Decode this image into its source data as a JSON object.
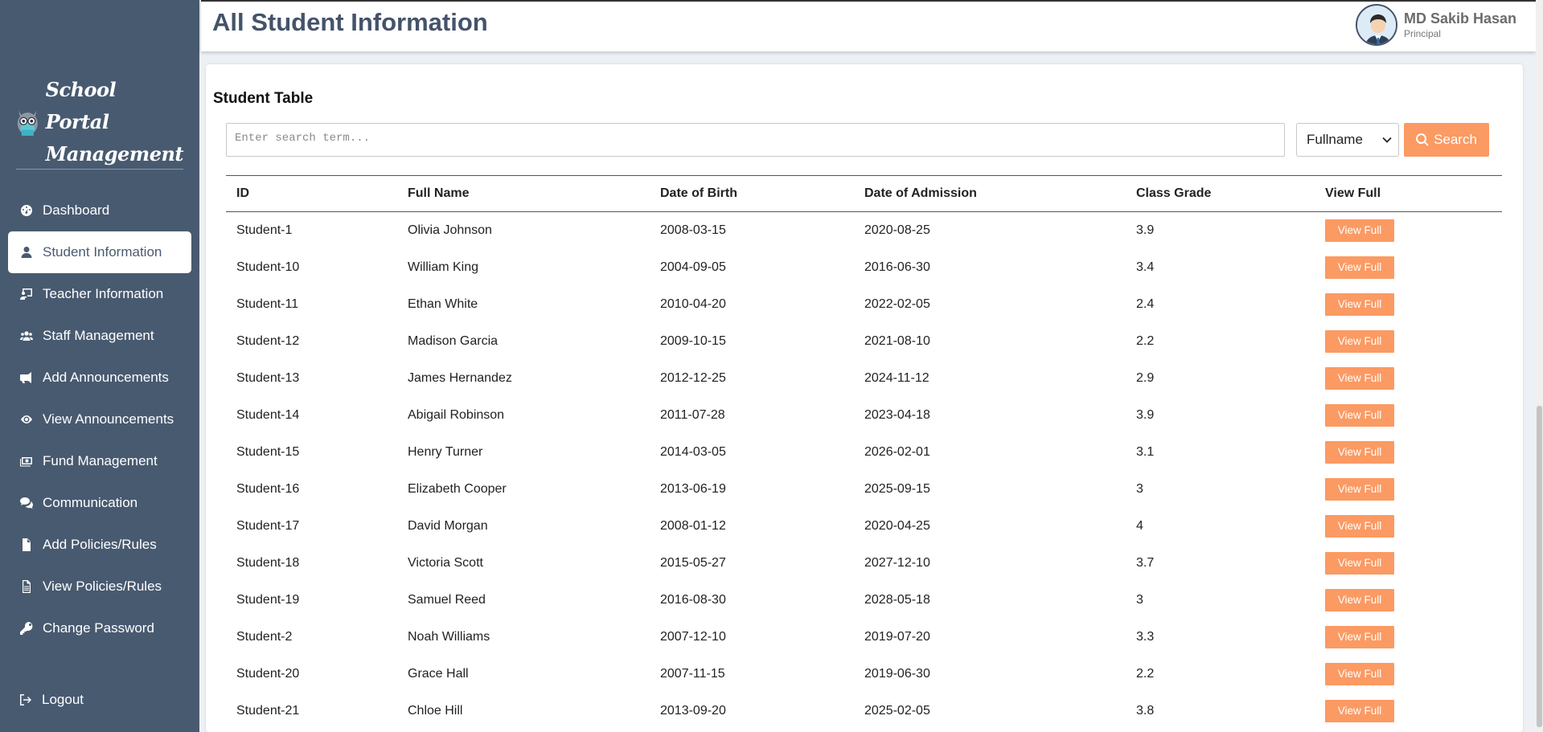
{
  "brand": {
    "line1": "School Portal",
    "line2": "Management"
  },
  "sidebar": {
    "items": [
      {
        "label": "Dashboard",
        "icon": "dashboard-icon"
      },
      {
        "label": "Student Information",
        "icon": "user-icon"
      },
      {
        "label": "Teacher Information",
        "icon": "chalkboard-icon"
      },
      {
        "label": "Staff Management",
        "icon": "users-icon"
      },
      {
        "label": "Add Announcements",
        "icon": "megaphone-icon"
      },
      {
        "label": "View Announcements",
        "icon": "eye-icon"
      },
      {
        "label": "Fund Management",
        "icon": "money-icon"
      },
      {
        "label": "Communication",
        "icon": "comments-icon"
      },
      {
        "label": "Add Policies/Rules",
        "icon": "file-icon"
      },
      {
        "label": "View Policies/Rules",
        "icon": "file-outline-icon"
      },
      {
        "label": "Change Password",
        "icon": "key-icon"
      }
    ],
    "active": "Student Information",
    "logout": "Logout"
  },
  "header": {
    "title": "All Student Information",
    "user_name": "MD Sakib Hasan",
    "user_role": "Principal"
  },
  "main": {
    "card_title": "Student Table",
    "search_placeholder": "Enter search term...",
    "filter_selected": "Fullname",
    "search_label": "Search",
    "columns": [
      "ID",
      "Full Name",
      "Date of Birth",
      "Date of Admission",
      "Class Grade",
      "View Full"
    ],
    "view_label": "View Full",
    "rows": [
      [
        "Student-1",
        "Olivia Johnson",
        "2008-03-15",
        "2020-08-25",
        "3.9"
      ],
      [
        "Student-10",
        "William King",
        "2004-09-05",
        "2016-06-30",
        "3.4"
      ],
      [
        "Student-11",
        "Ethan White",
        "2010-04-20",
        "2022-02-05",
        "2.4"
      ],
      [
        "Student-12",
        "Madison Garcia",
        "2009-10-15",
        "2021-08-10",
        "2.2"
      ],
      [
        "Student-13",
        "James Hernandez",
        "2012-12-25",
        "2024-11-12",
        "2.9"
      ],
      [
        "Student-14",
        "Abigail Robinson",
        "2011-07-28",
        "2023-04-18",
        "3.9"
      ],
      [
        "Student-15",
        "Henry Turner",
        "2014-03-05",
        "2026-02-01",
        "3.1"
      ],
      [
        "Student-16",
        "Elizabeth Cooper",
        "2013-06-19",
        "2025-09-15",
        "3"
      ],
      [
        "Student-17",
        "David Morgan",
        "2008-01-12",
        "2020-04-25",
        "4"
      ],
      [
        "Student-18",
        "Victoria Scott",
        "2015-05-27",
        "2027-12-10",
        "3.7"
      ],
      [
        "Student-19",
        "Samuel Reed",
        "2016-08-30",
        "2028-05-18",
        "3"
      ],
      [
        "Student-2",
        "Noah Williams",
        "2007-12-10",
        "2019-07-20",
        "3.3"
      ],
      [
        "Student-20",
        "Grace Hall",
        "2007-11-15",
        "2019-06-30",
        "2.2"
      ],
      [
        "Student-21",
        "Chloe Hill",
        "2013-09-20",
        "2025-02-05",
        "3.8"
      ]
    ]
  },
  "colors": {
    "sidebar": "#485a70",
    "accent": "#fb9a63",
    "title": "#44536a"
  }
}
